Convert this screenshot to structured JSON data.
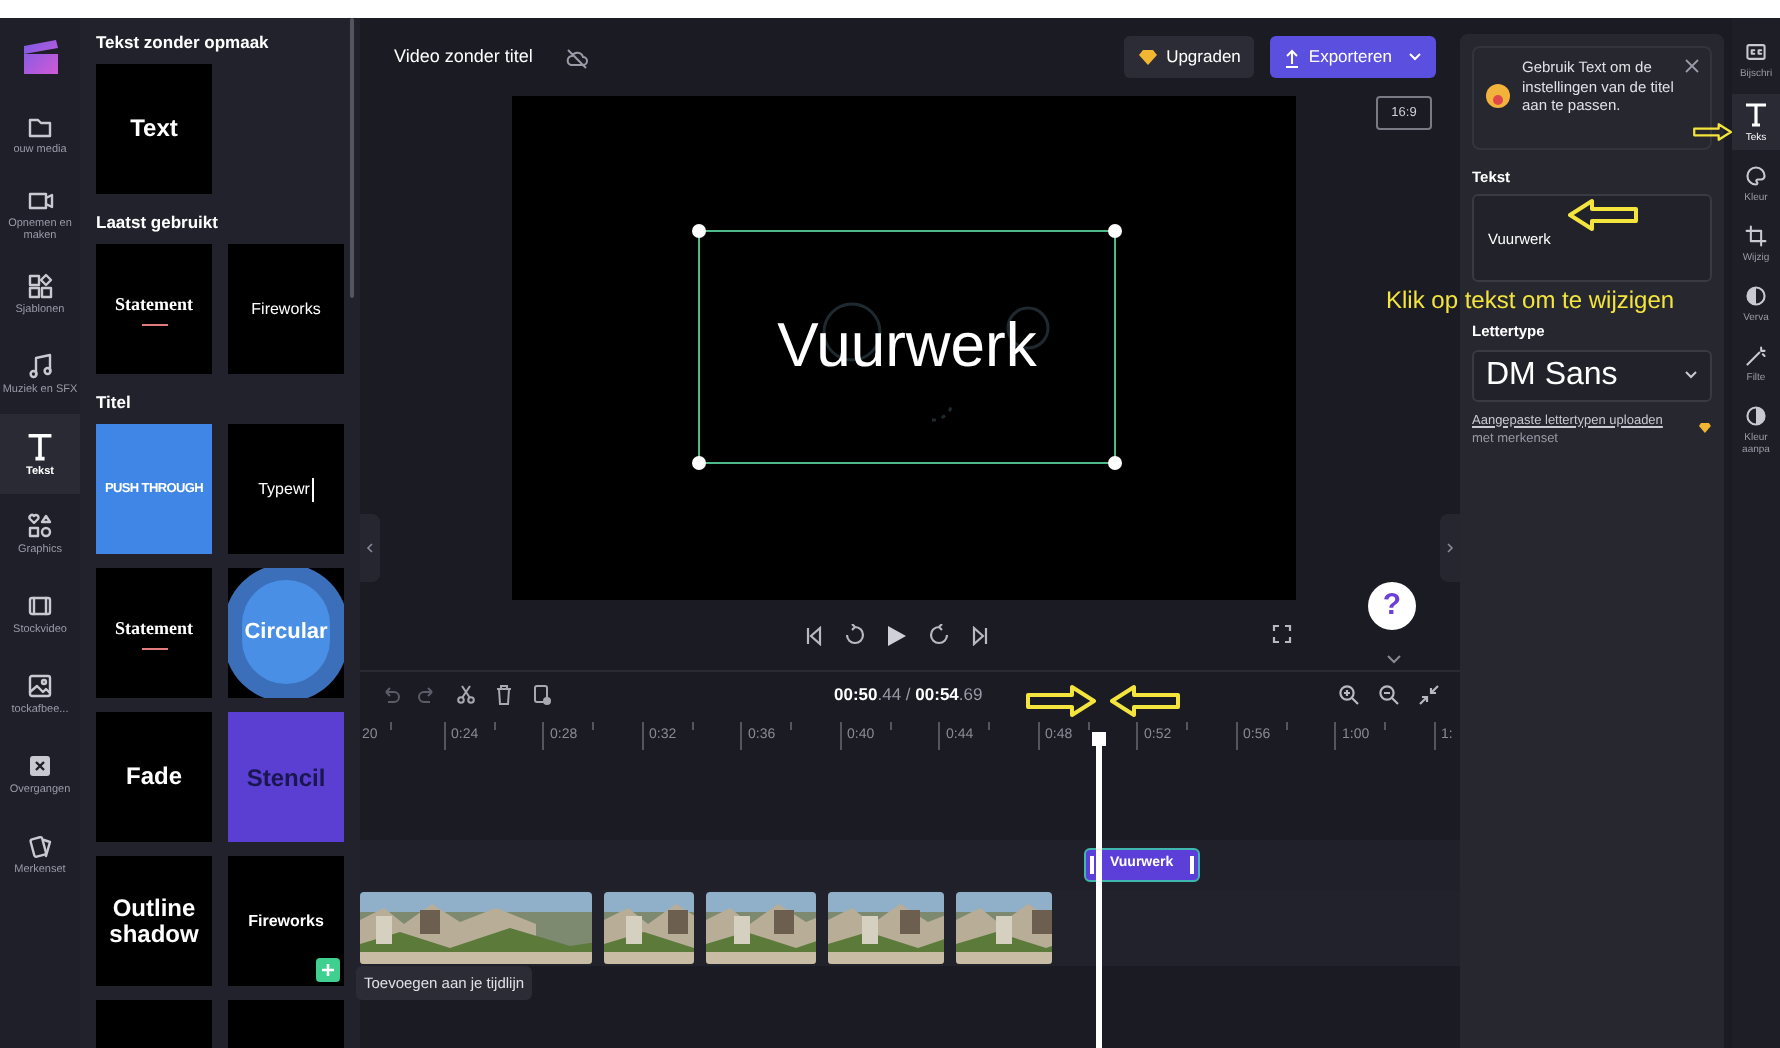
{
  "nav": {
    "items": [
      {
        "label": "ouw media",
        "selected": false
      },
      {
        "label": "Opnemen en maken",
        "selected": false
      },
      {
        "label": "Sjablonen",
        "selected": false
      },
      {
        "label": "Muziek en SFX",
        "selected": false
      },
      {
        "label": "Tekst",
        "selected": true
      },
      {
        "label": "Graphics",
        "selected": false
      },
      {
        "label": "Stockvideo",
        "selected": false
      },
      {
        "label": "tockafbee...",
        "selected": false
      },
      {
        "label": "Overgangen",
        "selected": false
      },
      {
        "label": "Merkenset",
        "selected": false
      }
    ]
  },
  "panel": {
    "sections": [
      {
        "title": "Tekst zonder opmaak",
        "cards": [
          {
            "label": "Text",
            "kind": "plain",
            "hovered": false
          }
        ]
      },
      {
        "title": "Laatst gebruikt",
        "cards": [
          {
            "label": "Statement",
            "kind": "statement",
            "hovered": false
          },
          {
            "label": "Fireworks",
            "kind": "fireworks",
            "hovered": false
          }
        ]
      },
      {
        "title": "Titel",
        "cards": [
          {
            "label": "PUSH THROUGH",
            "kind": "push",
            "hovered": false
          },
          {
            "label": "Typewr",
            "kind": "typewriter",
            "hovered": false
          },
          {
            "label": "Statement",
            "kind": "statement",
            "hovered": false
          },
          {
            "label": "Circular",
            "kind": "circular",
            "hovered": false
          },
          {
            "label": "Fade",
            "kind": "plain",
            "hovered": false
          },
          {
            "label": "Stencil",
            "kind": "stencil",
            "hovered": false
          },
          {
            "label": "Outline shadow",
            "kind": "plain",
            "hovered": false
          },
          {
            "label": "Fireworks",
            "kind": "plainsmall",
            "hovered": true
          },
          {
            "kind": "blank",
            "hovered": false
          },
          {
            "kind": "blank",
            "hovered": false
          }
        ]
      }
    ]
  },
  "tooltip": "Toevoegen aan je tijdlijn",
  "header": {
    "title": "Video zonder titel",
    "upgrade": "Upgraden",
    "export": "Exporteren"
  },
  "preview": {
    "aspect": "16:9",
    "text": "Vuurwerk",
    "selected": true
  },
  "help": "?",
  "timeline": {
    "time": "**00:50**.44",
    "separator": "/",
    "total": "**00:54**.69",
    "ticks": [
      "20",
      "0:24",
      "0:28",
      "0:32",
      "0:36",
      "0:40",
      "0:44",
      "0:48",
      "0:52",
      "0:56",
      "1:00",
      "1:"
    ],
    "text_clip": "Vuurwerk"
  },
  "properties": {
    "notice": "Gebruik Text om de instellingen van de titel aan te passen.",
    "text_label": "Tekst",
    "text_value": "Vuurwerk",
    "font_label": "Lettertype",
    "font_value": "DM Sans",
    "link": "Aangepaste lettertypen uploaden",
    "link_note": "met merkenset"
  },
  "annotation": "Klik op tekst om te wijzigen",
  "rail": {
    "items": [
      {
        "label": "Bijschri",
        "selected": false
      },
      {
        "label": "Teks",
        "selected": true
      },
      {
        "label": "Kleur",
        "selected": false
      },
      {
        "label": "Wijzig",
        "selected": false
      },
      {
        "label": "Verva",
        "selected": false
      },
      {
        "label": "Filte",
        "selected": false
      },
      {
        "label": "Kleur aanpa",
        "selected": false
      }
    ]
  }
}
